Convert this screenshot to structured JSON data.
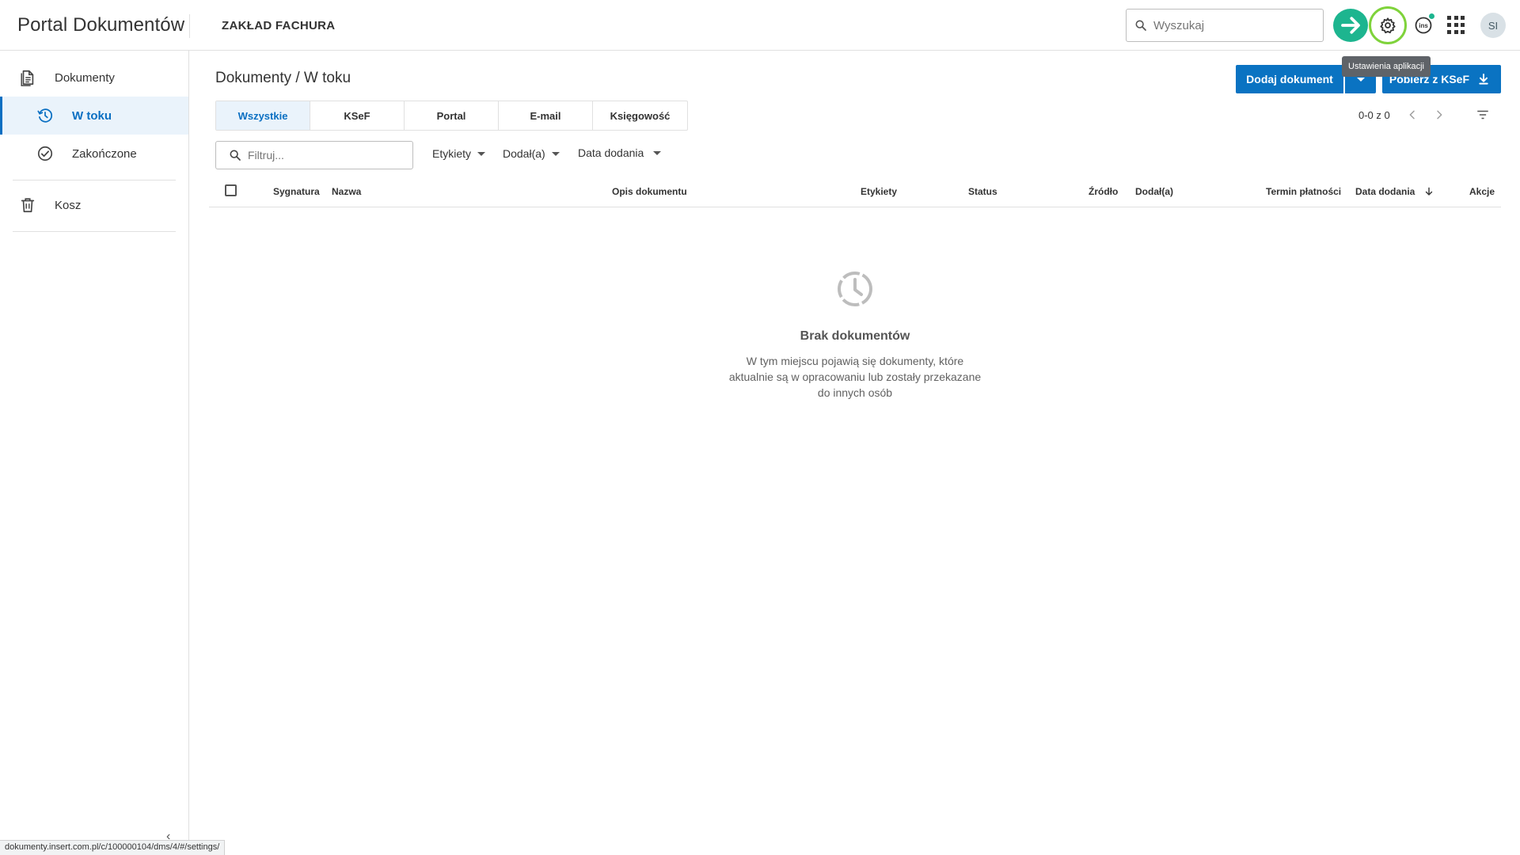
{
  "header": {
    "app_title": "Portal Dokumentów",
    "company": "ZAKŁAD FACHURA",
    "search_placeholder": "Wyszukaj",
    "avatar_initials": "SI",
    "tooltip": "Ustawienia aplikacji",
    "ins_label": "ins"
  },
  "sidebar": {
    "items": [
      {
        "label": "Dokumenty",
        "icon": "document-icon"
      },
      {
        "label": "W toku",
        "icon": "history-icon",
        "active": true
      },
      {
        "label": "Zakończone",
        "icon": "check-circle-icon"
      },
      {
        "label": "Kosz",
        "icon": "trash-icon"
      }
    ]
  },
  "main": {
    "breadcrumb": "Dokumenty / W toku",
    "add_button": "Dodaj dokument",
    "ksef_button": "Pobierz z KSeF",
    "tabs": [
      "Wszystkie",
      "KSeF",
      "Portal",
      "E-mail",
      "Księgowość"
    ],
    "pager": "0-0 z 0",
    "filter_placeholder": "Filtruj...",
    "filters": [
      "Etykiety",
      "Dodał(a)",
      "Data dodania"
    ],
    "columns": [
      "Sygnatura",
      "Nazwa",
      "Opis dokumentu",
      "Etykiety",
      "Status",
      "Źródło",
      "Dodał(a)",
      "Termin płatności",
      "Data dodania",
      "Akcje"
    ],
    "empty_title": "Brak dokumentów",
    "empty_text": "W tym miejscu pojawią się dokumenty, które aktualnie są w opracowaniu lub zostały przekazane do innych osób"
  },
  "statusbar": {
    "url": "dokumenty.insert.com.pl/c/100000104/dms/4/#/settings/"
  },
  "colors": {
    "primary": "#0a73c2",
    "accent_green": "#1db58f",
    "highlight_ring": "#7fd33b",
    "active_bg": "#eaf3fb"
  }
}
